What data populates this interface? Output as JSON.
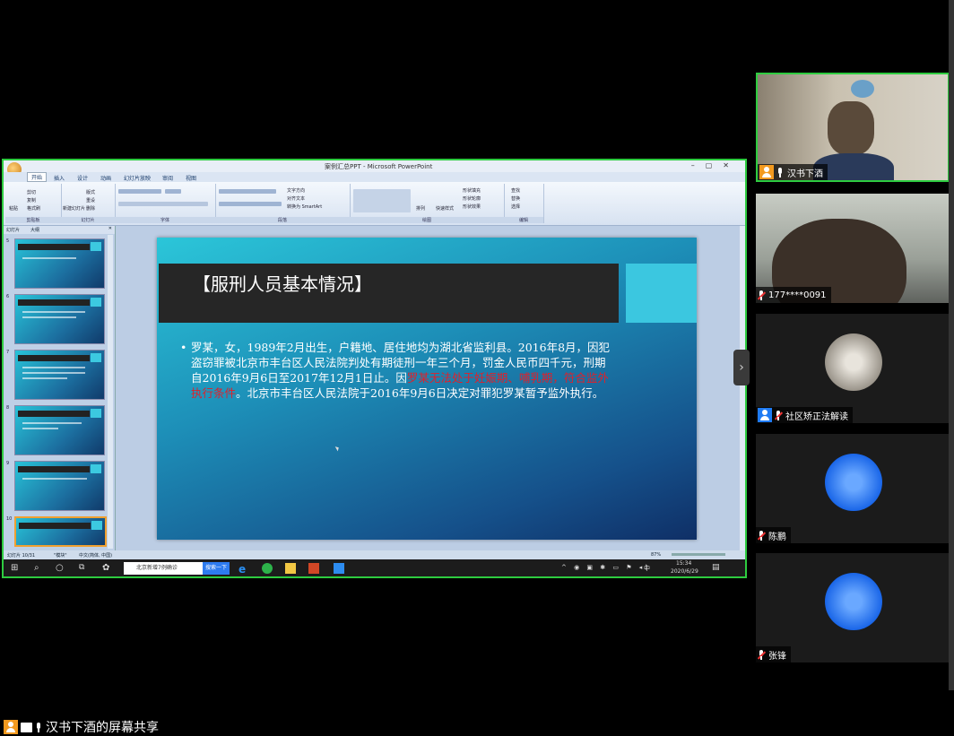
{
  "ppt": {
    "window_title": "Microsoft PowerPoint",
    "window_title_prefix": "案例汇总PPT",
    "tabs": [
      "开始",
      "插入",
      "设计",
      "动画",
      "幻灯片放映",
      "审阅",
      "视图"
    ],
    "groups": [
      "剪贴板",
      "幻灯片",
      "字体",
      "段落",
      "绘图",
      "编辑"
    ],
    "ribbon_labels": {
      "paste": "粘贴",
      "cut": "剪切",
      "copy": "复制",
      "format_painter": "格式刷",
      "layout": "版式",
      "reset": "重设",
      "delete": "删除",
      "new_slide": "新建幻灯片",
      "text_dir": "文字方向",
      "align_text": "对齐文本",
      "smartart": "转换为 SmartArt",
      "arrange": "排列",
      "quick_styles": "快速样式",
      "fill": "形状填充",
      "outline": "形状轮廓",
      "effects": "形状效果",
      "find": "查找",
      "replace": "替换",
      "select": "选择"
    },
    "pane_tabs": [
      "幻灯片",
      "大纲"
    ],
    "thumbnail_numbers": [
      "5",
      "6",
      "7",
      "8",
      "9",
      "10"
    ],
    "status": {
      "slide_info": "幻灯片 10/31",
      "theme": "\"模块\"",
      "lang": "中文(简体, 中国)",
      "zoom": "87%"
    },
    "taskbar": {
      "search_text": "北京新增7例确诊",
      "search_btn": "搜索一下",
      "time": "15:34",
      "date": "2020/6/29",
      "lang": "中"
    }
  },
  "slide": {
    "title": "【服刑人员基本情况】",
    "body_1": "罗某，女，1989年2月出生，户籍地、居住地均为湖北省监利县。2016年8月，因犯盗窃罪被北京市丰台区人民法院判处有期徒刑一年三个月，罚金人民币四千元，刑期自2016年9月6日至2017年12月1日止。因",
    "body_red": "罗某无法处于妊娠期、哺乳期，符合监外执行条件",
    "body_2": "。北京市丰台区人民法院于2016年9月6日决定对罪犯罗某暂予监外执行。"
  },
  "participants": [
    {
      "name": "汉书下酒",
      "avatar_color": "#f39a1f",
      "muted": false
    },
    {
      "name": "177****0091",
      "muted": true
    },
    {
      "name": "社区矫正法解读",
      "avatar_color": "#1f7bf3",
      "muted": true
    },
    {
      "name": "陈鹏",
      "muted": true
    },
    {
      "name": "张锋",
      "muted": true
    }
  ],
  "share_label": "汉书下酒的屏幕共享",
  "colors": {
    "active_border": "#2ecc40",
    "slide_red": "#e0202a",
    "accent_cyan": "#3bc7e0"
  }
}
